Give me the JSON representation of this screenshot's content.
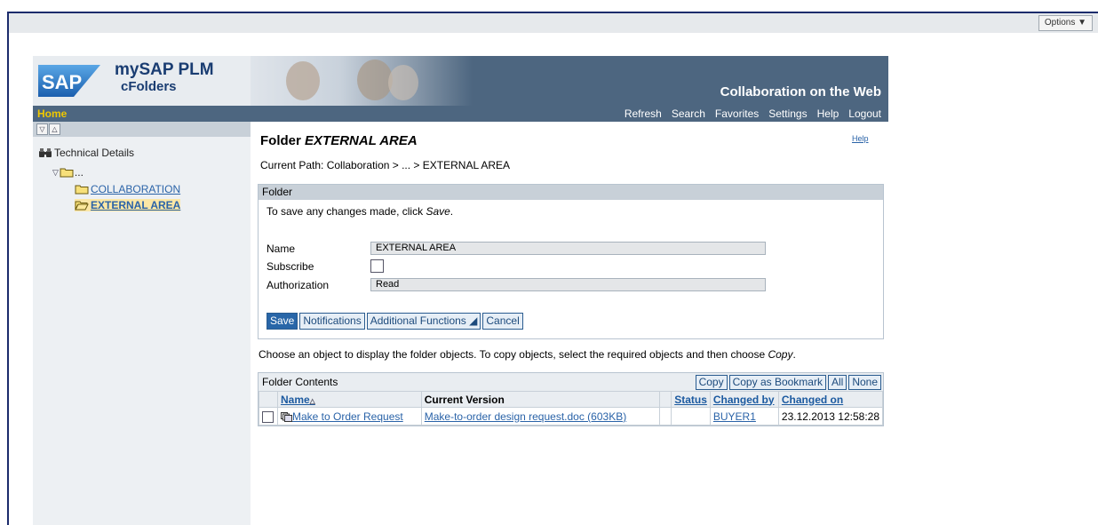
{
  "options_button": "Options ▼",
  "header": {
    "product_title": "mySAP PLM",
    "product_sub": "cFolders",
    "tagline": "Collaboration on the Web"
  },
  "nav": {
    "home": "Home",
    "links": [
      "Refresh",
      "Search",
      "Favorites",
      "Settings",
      "Help",
      "Logout"
    ]
  },
  "tree": {
    "technical_details": "Technical Details",
    "root_label": "...",
    "items": [
      {
        "label": "COLLABORATION",
        "selected": false
      },
      {
        "label": "EXTERNAL AREA",
        "selected": true
      }
    ]
  },
  "content": {
    "title_prefix": "Folder ",
    "title_name": "EXTERNAL AREA",
    "help": "Help",
    "path": "Current Path:  Collaboration > ... > EXTERNAL AREA"
  },
  "folder_panel": {
    "header": "Folder",
    "hint_prefix": "To save any changes made, click ",
    "hint_em": "Save",
    "hint_suffix": ".",
    "fields": {
      "name_label": "Name",
      "name_value": "EXTERNAL AREA",
      "subscribe_label": "Subscribe",
      "authorization_label": "Authorization",
      "authorization_value": "Read"
    },
    "buttons": {
      "save": "Save",
      "notifications": "Notifications",
      "additional": "Additional Functions ◢",
      "cancel": "Cancel"
    }
  },
  "choose_text_prefix": "Choose an object to display the folder objects. To copy objects, select the required objects and then choose ",
  "choose_text_em": "Copy",
  "choose_text_suffix": ".",
  "contents": {
    "header": "Folder Contents",
    "buttons": {
      "copy": "Copy",
      "copy_bookmark": "Copy as Bookmark",
      "all": "All",
      "none": "None"
    },
    "columns": {
      "name": "Name",
      "current_version": "Current Version",
      "status": "Status",
      "changed_by": "Changed by",
      "changed_on": "Changed on"
    },
    "rows": [
      {
        "name": "Make to Order Request",
        "version": "Make-to-order design request.doc (603KB)",
        "status": "",
        "changed_by": "BUYER1",
        "changed_on": "23.12.2013 12:58:28"
      }
    ]
  }
}
